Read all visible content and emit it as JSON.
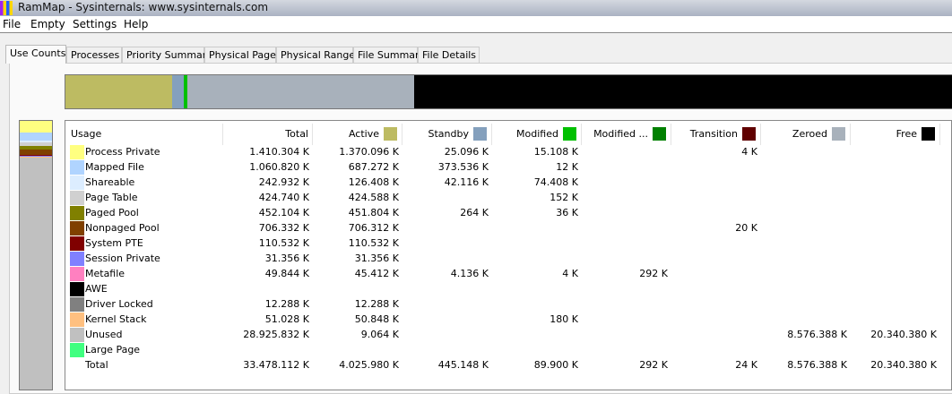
{
  "window": {
    "title": "RamMap - Sysinternals: www.sysinternals.com"
  },
  "menu": [
    "File",
    "Empty",
    "Settings",
    "Help"
  ],
  "tabs": [
    "Use Counts",
    "Processes",
    "Priority Summary",
    "Physical Pages",
    "Physical Ranges",
    "File Summary",
    "File Details"
  ],
  "columns": [
    {
      "label": "Usage"
    },
    {
      "label": "Total"
    },
    {
      "label": "Active",
      "color": "#bdbb62"
    },
    {
      "label": "Standby",
      "color": "#84a0bd"
    },
    {
      "label": "Modified",
      "color": "#00c000"
    },
    {
      "label": "Modified ...",
      "color": "#008000"
    },
    {
      "label": "Transition",
      "color": "#600000"
    },
    {
      "label": "Zeroed",
      "color": "#a8b1bb"
    },
    {
      "label": "Free",
      "color": "#000000"
    }
  ],
  "rows": [
    {
      "name": "Process Private",
      "color": "#ffff80",
      "v": [
        "1.410.304 K",
        "1.370.096 K",
        "25.096 K",
        "15.108 K",
        "",
        "4 K",
        "",
        ""
      ]
    },
    {
      "name": "Mapped File",
      "color": "#b0d4ff",
      "v": [
        "1.060.820 K",
        "687.272 K",
        "373.536 K",
        "12 K",
        "",
        "",
        "",
        ""
      ]
    },
    {
      "name": "Shareable",
      "color": "#dcedff",
      "v": [
        "242.932 K",
        "126.408 K",
        "42.116 K",
        "74.408 K",
        "",
        "",
        "",
        ""
      ]
    },
    {
      "name": "Page Table",
      "color": "#d0d0d0",
      "v": [
        "424.740 K",
        "424.588 K",
        "",
        "152 K",
        "",
        "",
        "",
        ""
      ]
    },
    {
      "name": "Paged Pool",
      "color": "#808000",
      "v": [
        "452.104 K",
        "451.804 K",
        "264 K",
        "36 K",
        "",
        "",
        "",
        ""
      ]
    },
    {
      "name": "Nonpaged Pool",
      "color": "#804000",
      "v": [
        "706.332 K",
        "706.312 K",
        "",
        "",
        "",
        "20 K",
        "",
        ""
      ]
    },
    {
      "name": "System PTE",
      "color": "#800000",
      "v": [
        "110.532 K",
        "110.532 K",
        "",
        "",
        "",
        "",
        "",
        ""
      ]
    },
    {
      "name": "Session Private",
      "color": "#8080ff",
      "v": [
        "31.356 K",
        "31.356 K",
        "",
        "",
        "",
        "",
        "",
        ""
      ]
    },
    {
      "name": "Metafile",
      "color": "#ff80c0",
      "v": [
        "49.844 K",
        "45.412 K",
        "4.136 K",
        "4 K",
        "292 K",
        "",
        "",
        ""
      ]
    },
    {
      "name": "AWE",
      "color": "#000000",
      "v": [
        "",
        "",
        "",
        "",
        "",
        "",
        "",
        ""
      ]
    },
    {
      "name": "Driver Locked",
      "color": "#808080",
      "v": [
        "12.288 K",
        "12.288 K",
        "",
        "",
        "",
        "",
        "",
        ""
      ]
    },
    {
      "name": "Kernel Stack",
      "color": "#ffc080",
      "v": [
        "51.028 K",
        "50.848 K",
        "",
        "180 K",
        "",
        "",
        "",
        ""
      ]
    },
    {
      "name": "Unused",
      "color": "#c0c0c0",
      "v": [
        "28.925.832 K",
        "9.064 K",
        "",
        "",
        "",
        "",
        "8.576.388 K",
        "20.340.380 K"
      ]
    },
    {
      "name": "Large Page",
      "color": "#40ff80",
      "v": [
        "",
        "",
        "",
        "",
        "",
        "",
        "",
        ""
      ]
    },
    {
      "name": "Total",
      "color": "",
      "v": [
        "33.478.112 K",
        "4.025.980 K",
        "445.148 K",
        "89.900 K",
        "292 K",
        "24 K",
        "8.576.388 K",
        "20.340.380 K"
      ]
    }
  ],
  "top_bar_kb": {
    "active": 4025980,
    "standby": 445148,
    "modified": 89900,
    "modified_no_write": 292,
    "transition": 24,
    "zeroed": 8576388,
    "free": 20340380
  }
}
